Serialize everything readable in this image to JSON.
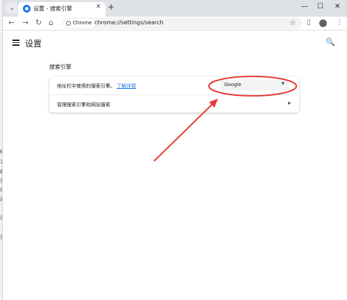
{
  "background_window": {
    "fragments": [
      "6",
      "7",
      "8",
      "示",
      "以",
      "兴",
      "示",
      "示"
    ]
  },
  "tabstrip": {
    "tab_search_glyph": "⌄",
    "active_tab": {
      "title": "设置 - 搜索引擎",
      "icon": "settings-icon",
      "close_glyph": "✕"
    },
    "new_tab_glyph": "+",
    "minimize_glyph": "—",
    "maximize_glyph": "☐",
    "close_glyph": "✕"
  },
  "toolbar": {
    "back_glyph": "←",
    "forward_glyph": "→",
    "reload_glyph": "↻",
    "home_glyph": "⌂",
    "site_chip_label": "Chrome",
    "url": "chrome://settings/search",
    "star_glyph": "☆",
    "sidepanel_glyph": "▯",
    "menu_glyph": "⋮"
  },
  "settings": {
    "page_title": "设置",
    "search_glyph": "🔍",
    "section_title": "搜索引擎",
    "rows": {
      "address_bar_engine": {
        "label": "地址栏中使用的搜索引擎。",
        "link_text": "了解详情",
        "selected_value": "Google",
        "caret_glyph": "▼"
      },
      "manage_engines": {
        "label": "管理搜索引擎和网站搜索",
        "arrow_glyph": "▶"
      }
    }
  },
  "annotation": {
    "color": "#e53935"
  },
  "colors": {
    "tabstrip_bg": "#dee1e6",
    "accent_blue": "#1a73e8",
    "annotation_red": "#e53935"
  }
}
